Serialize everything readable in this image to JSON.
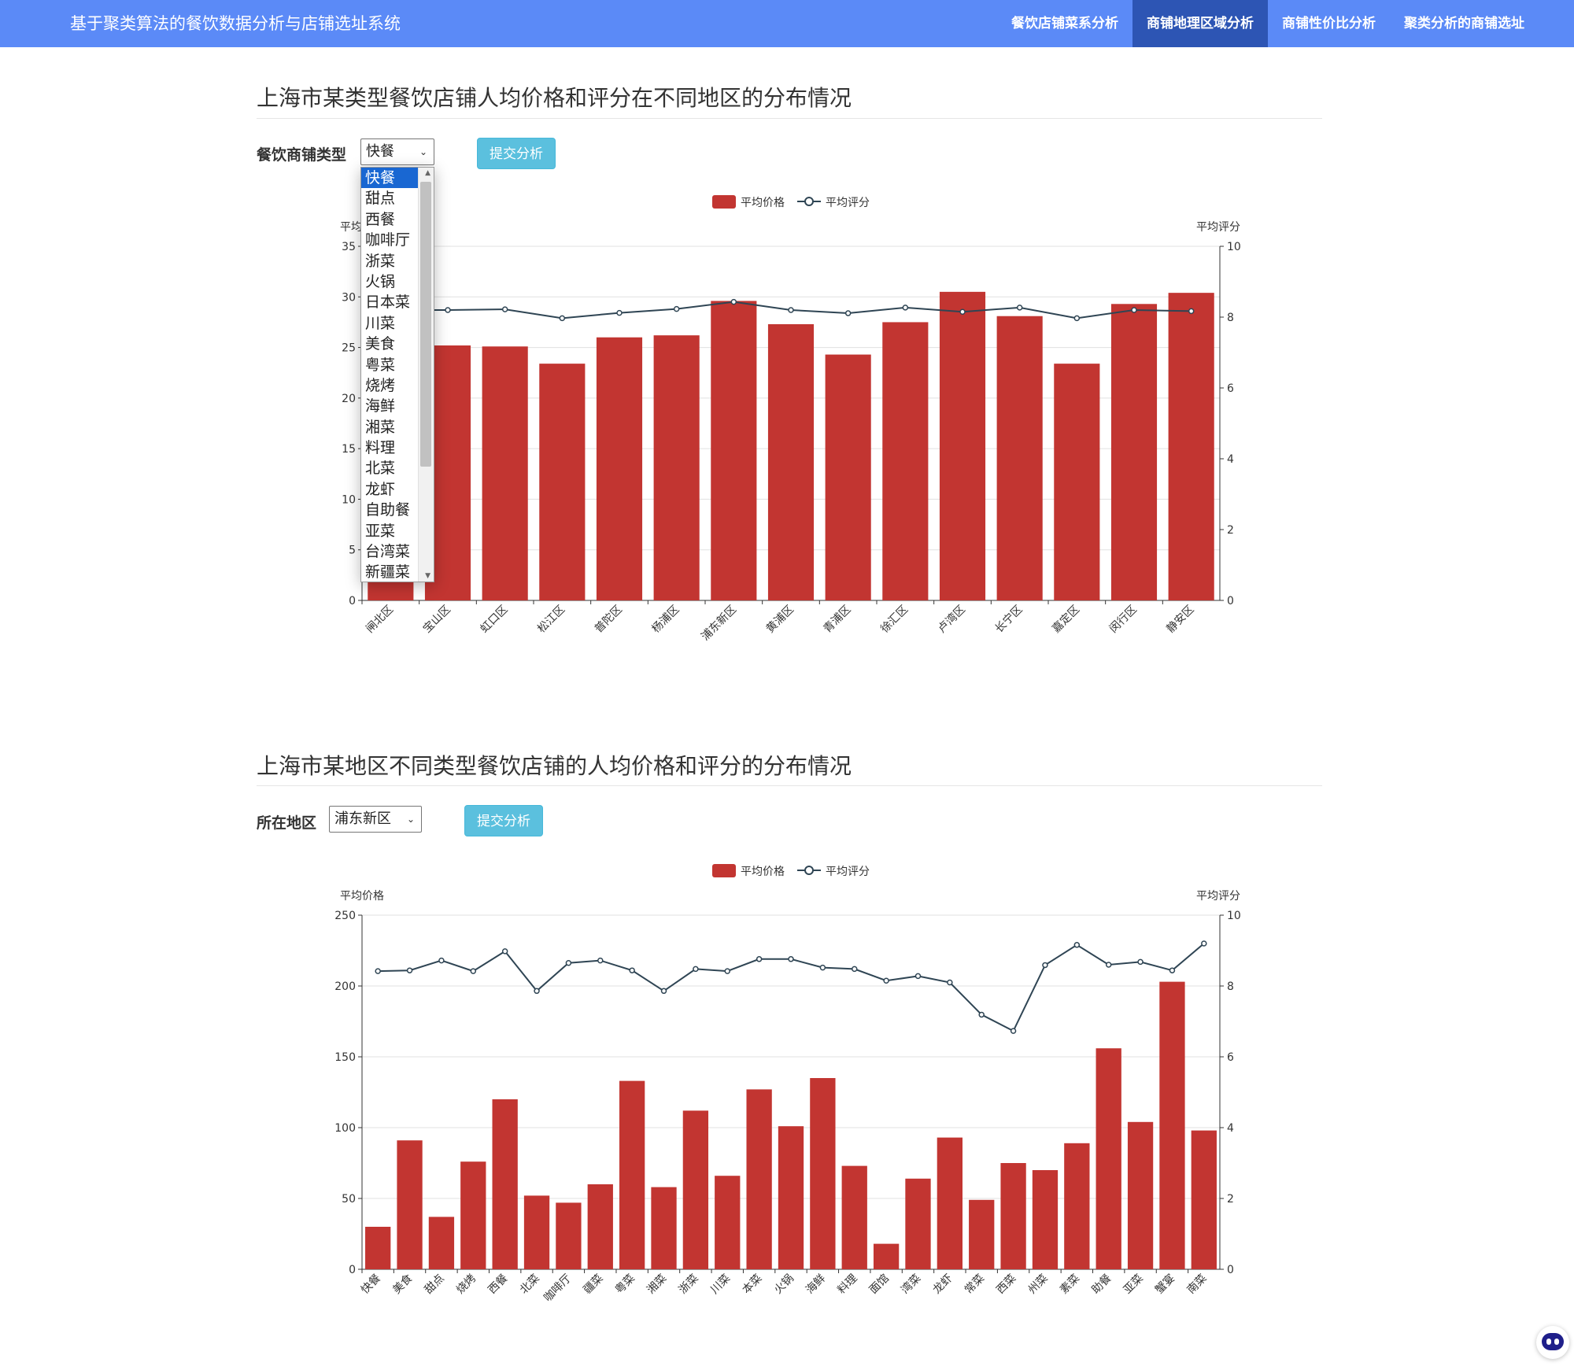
{
  "navbar": {
    "brand": "基于聚类算法的餐饮数据分析与店铺选址系统",
    "items": [
      {
        "label": "餐饮店铺菜系分析",
        "active": false
      },
      {
        "label": "商铺地理区域分析",
        "active": true
      },
      {
        "label": "商铺性价比分析",
        "active": false
      },
      {
        "label": "聚类分析的商铺选址",
        "active": false
      }
    ]
  },
  "section1": {
    "title": "上海市某类型餐饮店铺人均价格和评分在不同地区的分布情况",
    "label": "餐饮商铺类型",
    "selected": "快餐",
    "submit": "提交分析",
    "options": [
      "快餐",
      "甜点",
      "西餐",
      "咖啡厅",
      "浙菜",
      "火锅",
      "日本菜",
      "川菜",
      "美食",
      "粤菜",
      "烧烤",
      "海鲜",
      "湘菜",
      "料理",
      "北菜",
      "龙虾",
      "自助餐",
      "亚菜",
      "台湾菜",
      "新疆菜"
    ]
  },
  "section2": {
    "title": "上海市某地区不同类型餐饮店铺的人均价格和评分的分布情况",
    "label": "所在地区",
    "selected": "浦东新区",
    "submit": "提交分析"
  },
  "colors": {
    "bar": "#c23531",
    "line": "#2f4554",
    "nav": "#5b8af7",
    "nav_active": "#2d55b4",
    "button": "#5bc0de"
  },
  "chart_data": [
    {
      "type": "bar",
      "legend": [
        "平均价格",
        "平均评分"
      ],
      "ylabel": "平均价格",
      "ylabel_right": "平均评分",
      "ylim": [
        0,
        35
      ],
      "ylim_right": [
        0,
        10
      ],
      "yticks": [
        0,
        5,
        10,
        15,
        20,
        25,
        30,
        35
      ],
      "yticks_right": [
        0,
        2,
        4,
        6,
        8,
        10
      ],
      "categories": [
        "闸北区",
        "宝山区",
        "虹口区",
        "松江区",
        "普陀区",
        "杨浦区",
        "浦东新区",
        "黄浦区",
        "青浦区",
        "徐汇区",
        "卢湾区",
        "长宁区",
        "嘉定区",
        "闵行区",
        "静安区"
      ],
      "series": [
        {
          "name": "平均价格",
          "type": "bar",
          "values": [
            26.0,
            25.2,
            25.1,
            23.4,
            26.0,
            26.2,
            29.6,
            27.3,
            24.3,
            27.5,
            30.5,
            28.1,
            23.4,
            29.3,
            30.4
          ]
        },
        {
          "name": "平均评分",
          "type": "line",
          "values": [
            8.2,
            8.2,
            8.22,
            7.97,
            8.12,
            8.23,
            8.43,
            8.2,
            8.11,
            8.27,
            8.15,
            8.27,
            7.97,
            8.2,
            8.17
          ]
        }
      ]
    },
    {
      "type": "bar",
      "legend": [
        "平均价格",
        "平均评分"
      ],
      "ylabel": "平均价格",
      "ylabel_right": "平均评分",
      "ylim": [
        0,
        250
      ],
      "ylim_right": [
        0,
        10
      ],
      "yticks": [
        0,
        50,
        100,
        150,
        200,
        250
      ],
      "yticks_right": [
        0,
        2,
        4,
        6,
        8,
        10
      ],
      "categories": [
        "快餐",
        "美食",
        "甜点",
        "烧烤",
        "西餐",
        "北菜",
        "咖啡厅",
        "疆菜",
        "粤菜",
        "湘菜",
        "浙菜",
        "川菜",
        "本菜",
        "火锅",
        "海鲜",
        "料理",
        "面馆",
        "湾菜",
        "龙虾",
        "常菜",
        "西菜",
        "州菜",
        "素菜",
        "助餐",
        "亚菜",
        "蟹宴",
        "南菜"
      ],
      "series": [
        {
          "name": "平均价格",
          "type": "bar",
          "values": [
            30,
            91,
            37,
            76,
            120,
            52,
            47,
            60,
            133,
            58,
            112,
            66,
            127,
            101,
            135,
            73,
            18,
            64,
            93,
            49,
            75,
            70,
            89,
            156,
            104,
            203,
            98
          ]
        },
        {
          "name": "平均评分",
          "type": "line",
          "values": [
            8.42,
            8.44,
            8.72,
            8.42,
            8.98,
            7.86,
            8.65,
            8.72,
            8.44,
            7.86,
            8.48,
            8.42,
            8.76,
            8.76,
            8.52,
            8.48,
            8.15,
            8.28,
            8.1,
            7.19,
            6.73,
            8.59,
            9.16,
            8.6,
            8.68,
            8.44,
            9.2
          ]
        }
      ]
    }
  ]
}
